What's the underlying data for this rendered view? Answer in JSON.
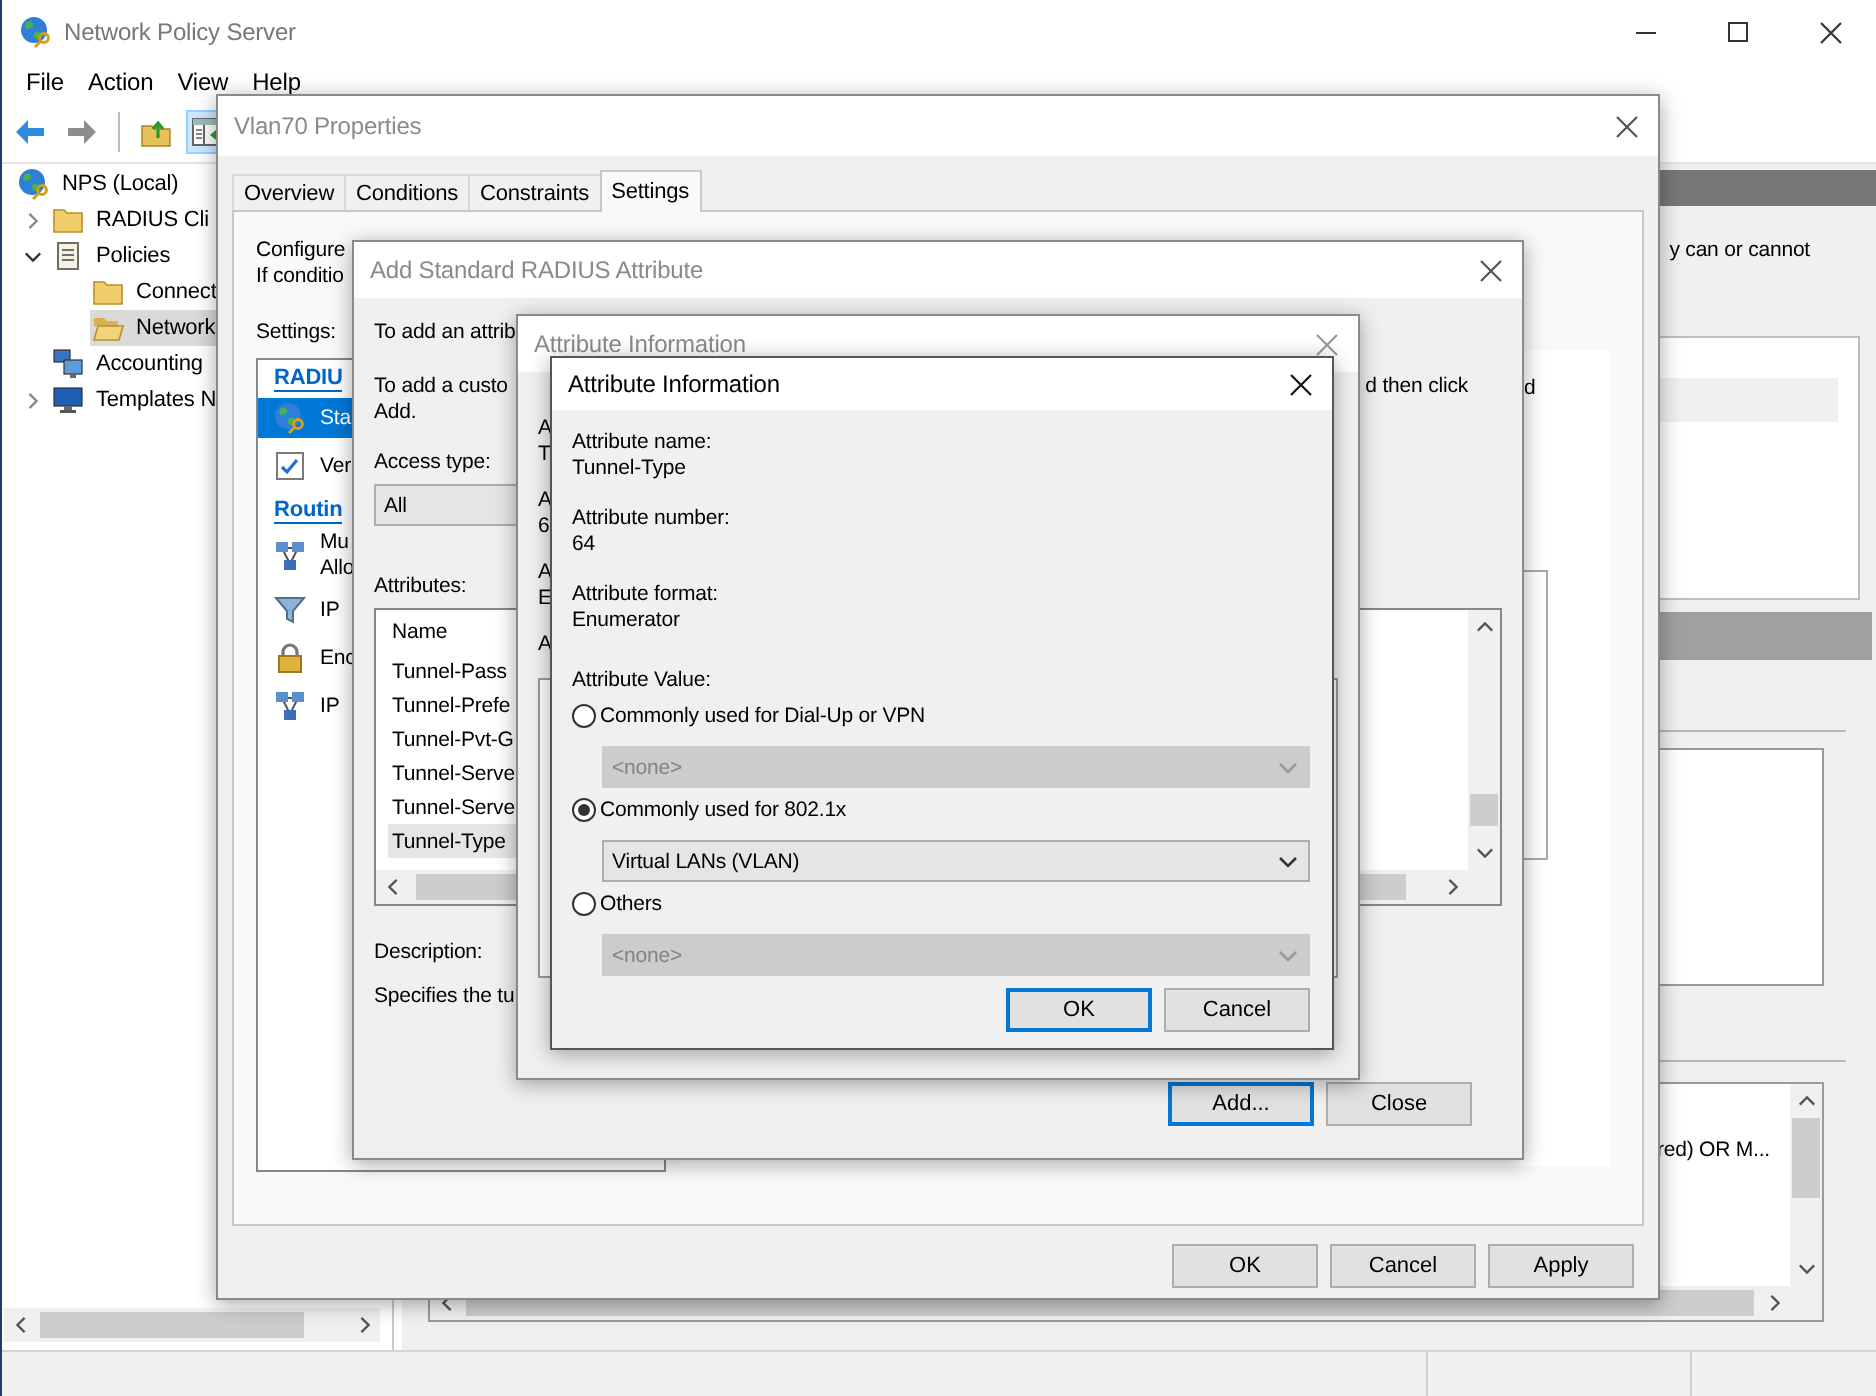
{
  "window": {
    "title": "Network Policy Server"
  },
  "menu": [
    "File",
    "Action",
    "View",
    "Help"
  ],
  "toolbar": [
    {
      "kind": "back",
      "disabled": false
    },
    {
      "kind": "forward",
      "disabled": true
    },
    {
      "kind": "up",
      "disabled": false
    },
    {
      "kind": "pane",
      "pressed": true
    }
  ],
  "tree": [
    {
      "label": "NPS (Local)",
      "kind": "server",
      "selected": false,
      "children": [
        {
          "label": "RADIUS Cli",
          "kind": "folder",
          "expanded": false,
          "selected": false
        },
        {
          "label": "Policies",
          "kind": "policy",
          "expanded": true,
          "selected": false,
          "children": [
            {
              "label": "Connect",
              "kind": "folder",
              "selected": false
            },
            {
              "label": "Network",
              "kind": "folder",
              "selected": true
            }
          ]
        },
        {
          "label": "Accounting",
          "kind": "accounting",
          "selected": false
        },
        {
          "label": "Templates N",
          "kind": "templates",
          "expanded": false,
          "selected": false
        }
      ]
    }
  ],
  "details": {
    "note": "y can or cannot",
    "list_text": "red) OR M..."
  },
  "properties": {
    "title": "Vlan70 Properties",
    "tabs": [
      {
        "label": "Overview",
        "selected": false
      },
      {
        "label": "Conditions",
        "selected": false
      },
      {
        "label": "Constraints",
        "selected": false
      },
      {
        "label": "Settings",
        "selected": true
      }
    ],
    "intro": [
      "Configure",
      "If conditio"
    ],
    "right_fragment": "d",
    "settings_label": "Settings:",
    "settings": [
      {
        "kind": "header",
        "label": "RADIU"
      },
      {
        "kind": "globe",
        "lines": [
          "Sta"
        ],
        "selected": true
      },
      {
        "kind": "checklist",
        "lines": [
          "Ver"
        ],
        "selected": false
      },
      {
        "kind": "header",
        "label": "Routin"
      },
      {
        "kind": "network",
        "lines": [
          "Mu",
          "Allo"
        ],
        "selected": false
      },
      {
        "kind": "filter",
        "lines": [
          "IP"
        ],
        "selected": false
      },
      {
        "kind": "lock",
        "lines": [
          "Enc"
        ],
        "selected": false
      },
      {
        "kind": "network",
        "lines": [
          "IP"
        ],
        "selected": false
      }
    ],
    "buttons": [
      "OK",
      "Cancel",
      "Apply"
    ]
  },
  "add_attribute": {
    "title": "Add Standard RADIUS Attribute",
    "text_1": "To add an attrib",
    "text_2": "To add a custo",
    "text_2_right": "d then click",
    "text_3": "Add.",
    "access_type_label": "Access type:",
    "access_type": "All",
    "attributes_label": "Attributes:",
    "column": "Name",
    "rows": [
      {
        "name": "Tunnel-Pass",
        "selected": false
      },
      {
        "name": "Tunnel-Prefe",
        "selected": false
      },
      {
        "name": "Tunnel-Pvt-G",
        "selected": false
      },
      {
        "name": "Tunnel-Serve",
        "selected": false
      },
      {
        "name": "Tunnel-Serve",
        "selected": false
      },
      {
        "name": "Tunnel-Type",
        "selected": true
      }
    ],
    "description_label": "Description:",
    "description": "Specifies the tu",
    "buttons": [
      {
        "label": "Add...",
        "focused": true
      },
      {
        "label": "Close",
        "focused": false
      }
    ]
  },
  "attribute_info_behind": {
    "title": "Attribute Information",
    "fragments": [
      [
        "A",
        "T"
      ],
      [
        "A",
        "6"
      ],
      [
        "A",
        "E"
      ],
      [
        "A"
      ]
    ]
  },
  "attribute_info": {
    "title": "Attribute Information",
    "fields": [
      {
        "label": "Attribute name:",
        "value": "Tunnel-Type"
      },
      {
        "label": "Attribute number:",
        "value": "64"
      },
      {
        "label": "Attribute format:",
        "value": "Enumerator"
      }
    ],
    "value_label": "Attribute Value:",
    "options": [
      {
        "label": "Commonly used for Dial-Up or VPN",
        "selected": false,
        "dropdown": {
          "value": "<none>",
          "disabled": true
        }
      },
      {
        "label": "Commonly used for 802.1x",
        "selected": true,
        "dropdown": {
          "value": "Virtual LANs (VLAN)",
          "disabled": false
        }
      },
      {
        "label": "Others",
        "selected": false,
        "dropdown": {
          "value": "<none>",
          "disabled": true
        }
      }
    ],
    "buttons": [
      {
        "label": "OK",
        "focused": true
      },
      {
        "label": "Cancel",
        "focused": false
      }
    ]
  }
}
